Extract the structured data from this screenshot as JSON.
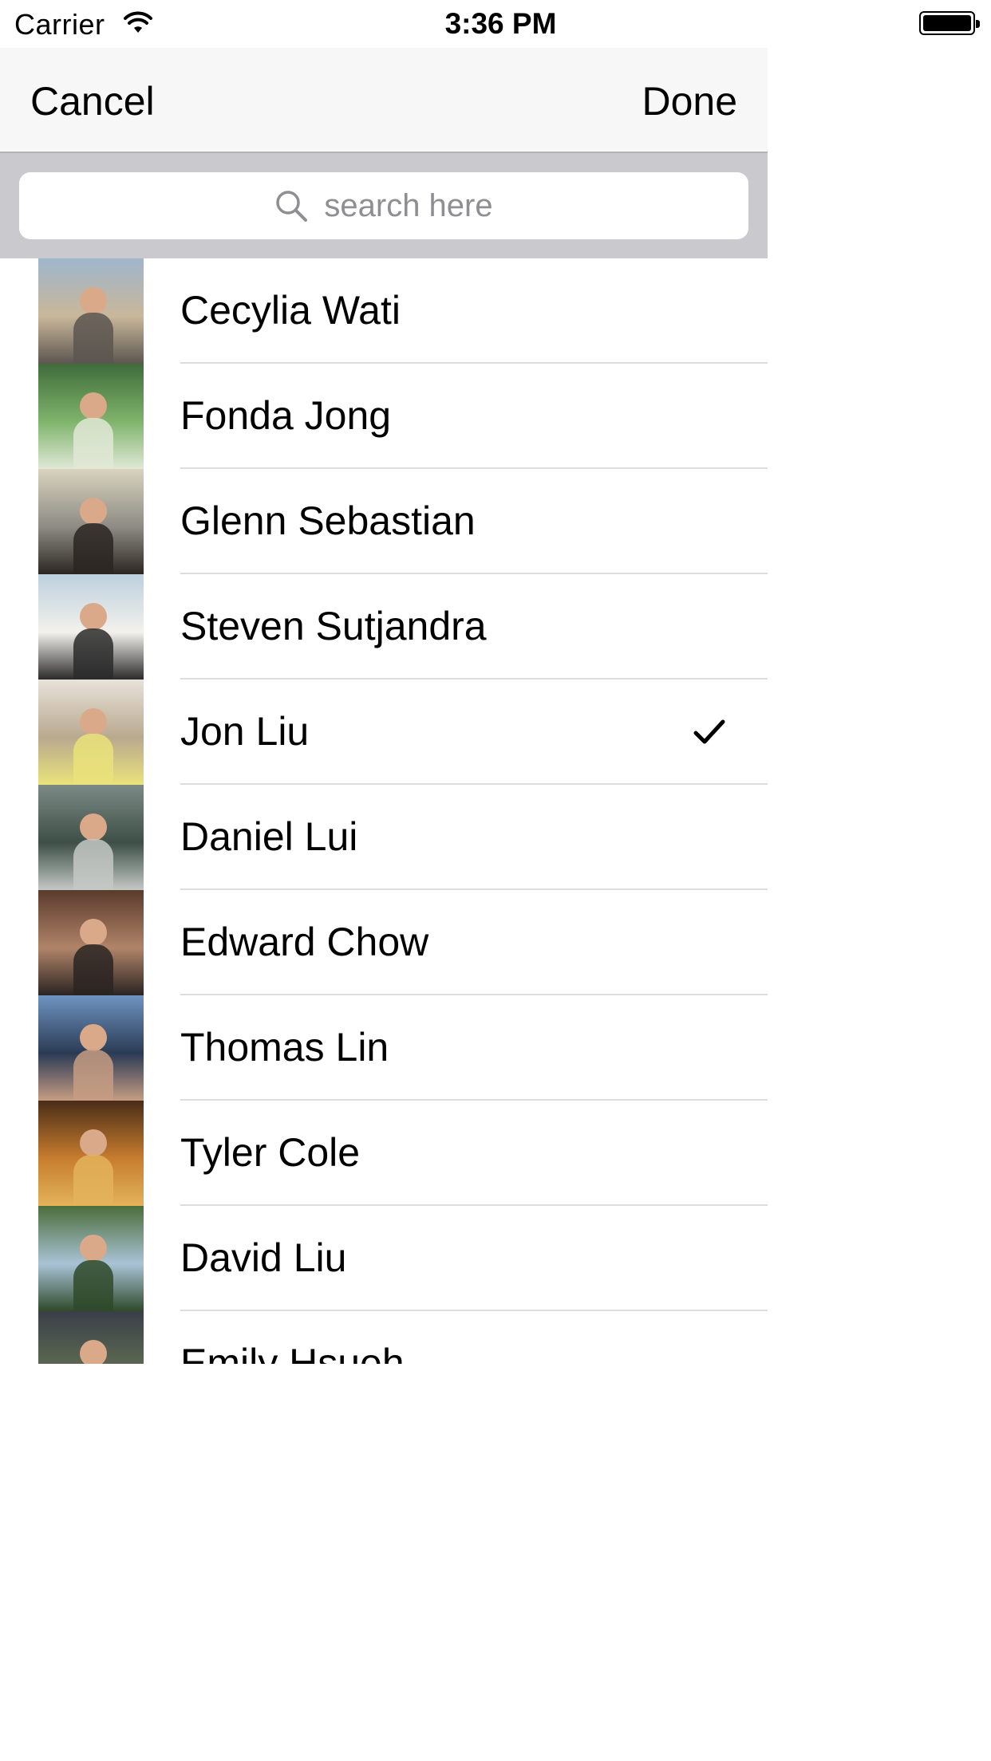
{
  "status_bar": {
    "carrier": "Carrier",
    "time": "3:36 PM"
  },
  "navbar": {
    "cancel_label": "Cancel",
    "done_label": "Done"
  },
  "search": {
    "placeholder": "search here",
    "icon": "search-icon"
  },
  "contacts": [
    {
      "name": "Cecylia Wati",
      "selected": false,
      "photo_colors": [
        "#9fb6cc",
        "#c9b79a",
        "#5c5650"
      ]
    },
    {
      "name": "Fonda Jong",
      "selected": false,
      "photo_colors": [
        "#3f6b3b",
        "#7fb46c",
        "#e0e8d6"
      ]
    },
    {
      "name": "Glenn Sebastian",
      "selected": false,
      "photo_colors": [
        "#d9d3bf",
        "#8d8b83",
        "#2c2622"
      ]
    },
    {
      "name": "Steven Sutjandra",
      "selected": false,
      "photo_colors": [
        "#bcd0de",
        "#f3f1ec",
        "#2b2b2b"
      ]
    },
    {
      "name": "Jon Liu",
      "selected": true,
      "photo_colors": [
        "#e8e2da",
        "#b9a98f",
        "#eae27a"
      ]
    },
    {
      "name": "Daniel Lui",
      "selected": false,
      "photo_colors": [
        "#7c8a86",
        "#3d4f46",
        "#c4c8c6"
      ]
    },
    {
      "name": "Edward Chow",
      "selected": false,
      "photo_colors": [
        "#5a3a2c",
        "#b08468",
        "#2a2422"
      ]
    },
    {
      "name": "Thomas Lin",
      "selected": false,
      "photo_colors": [
        "#6f94c1",
        "#2b3b55",
        "#c69c82"
      ]
    },
    {
      "name": "Tyler Cole",
      "selected": false,
      "photo_colors": [
        "#4a2c17",
        "#c77d2f",
        "#e3b35a"
      ]
    },
    {
      "name": "David Liu",
      "selected": false,
      "photo_colors": [
        "#4b6d3a",
        "#a9c3d6",
        "#2f4a2a"
      ]
    },
    {
      "name": "Emily Hsueh",
      "selected": false,
      "photo_colors": [
        "#3a3f48",
        "#5e6a52",
        "#2a2b2f"
      ]
    }
  ],
  "colors": {
    "navbar_bg": "#f7f7f7",
    "search_bar_bg": "#c9c9ce",
    "separator": "#dcdcdc",
    "placeholder": "#8e8e93"
  }
}
